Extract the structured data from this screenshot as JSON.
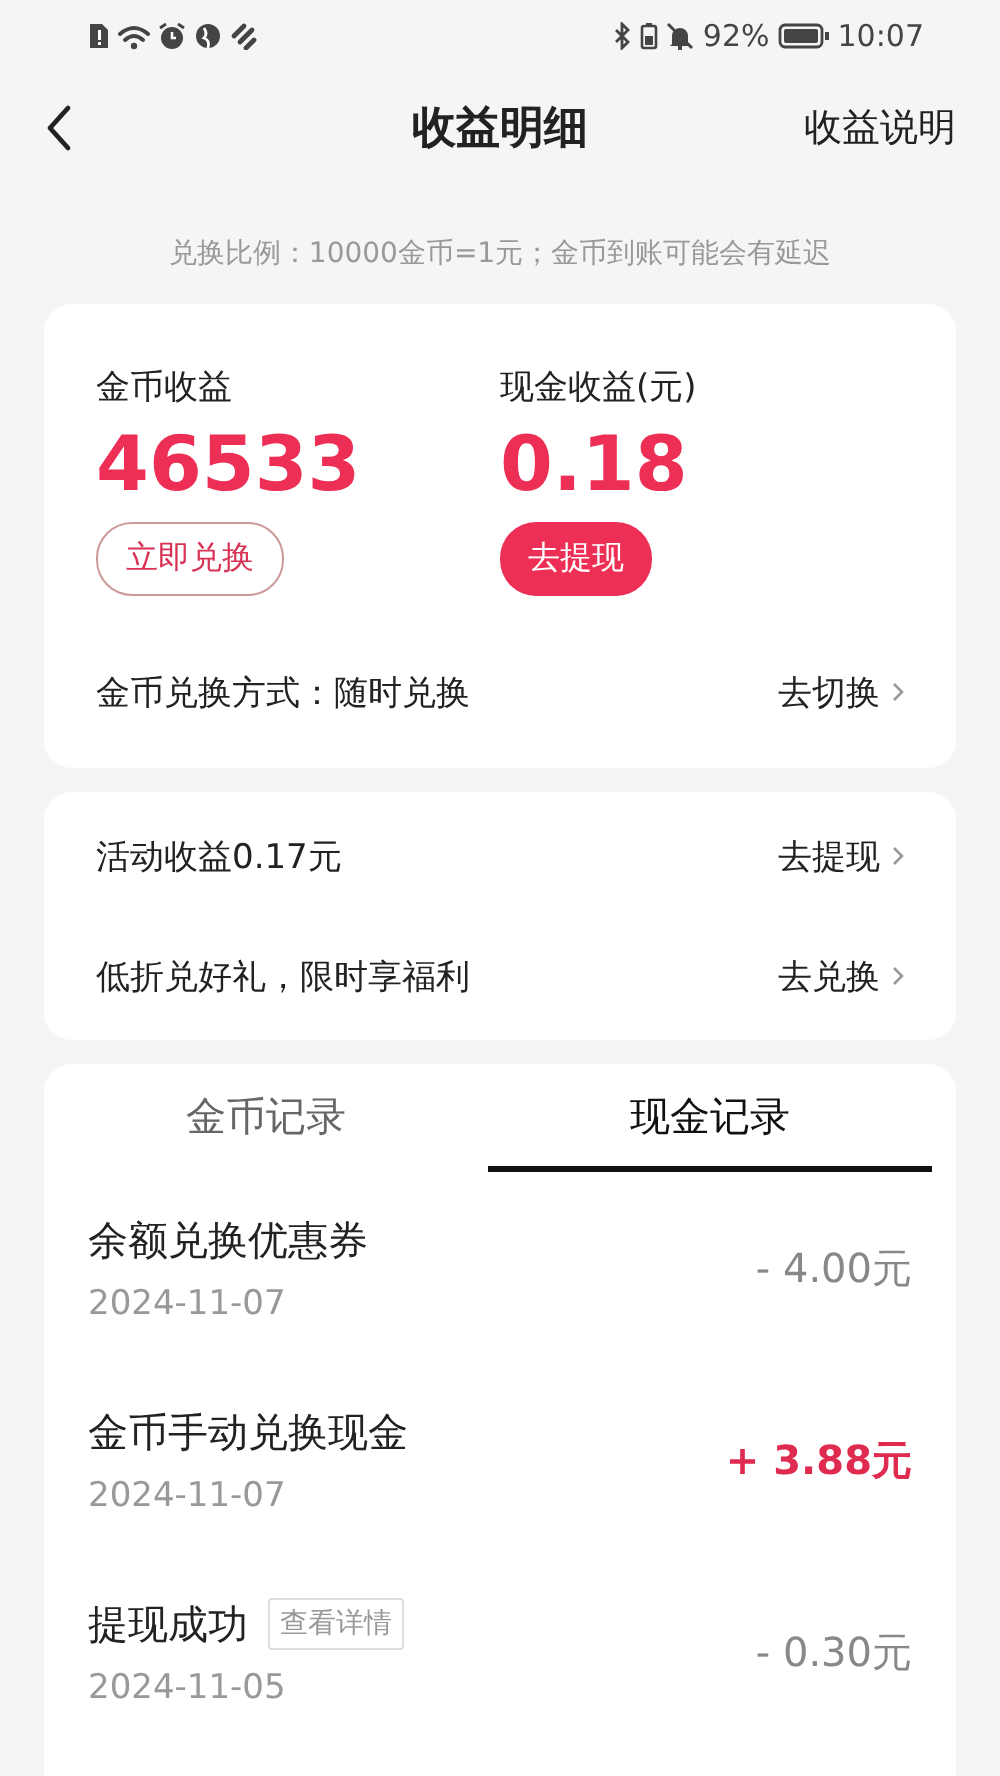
{
  "status_bar": {
    "battery_percent": "92%",
    "time": "10:07"
  },
  "header": {
    "title": "收益明细",
    "action": "收益说明"
  },
  "notice": "兑换比例：10000金币=1元；金币到账可能会有延迟",
  "earnings": [
    {
      "label": "金币收益",
      "value": "46533",
      "button": "立即兑换",
      "kind": "outline"
    },
    {
      "label": "现金收益(元)",
      "value": "0.18",
      "button": "去提现",
      "kind": "filled"
    }
  ],
  "exchange_mode": {
    "label": "金币兑换方式：随时兑换",
    "action": "去切换"
  },
  "promotions": [
    {
      "label": "活动收益0.17元",
      "action": "去提现"
    },
    {
      "label": "低折兑好礼，限时享福利",
      "action": "去兑换"
    }
  ],
  "tabs": [
    {
      "label": "金币记录",
      "selected": false
    },
    {
      "label": "现金记录",
      "selected": true
    }
  ],
  "records": [
    {
      "title": "余额兑换优惠券",
      "date": "2024-11-07",
      "amount": "- 4.00元",
      "kind": "expense"
    },
    {
      "title": "金币手动兑换现金",
      "date": "2024-11-07",
      "amount": "+ 3.88元",
      "kind": "income"
    },
    {
      "title": "提现成功",
      "tag": "查看详情",
      "date": "2024-11-05",
      "amount": "- 0.30元",
      "kind": "expense"
    }
  ]
}
